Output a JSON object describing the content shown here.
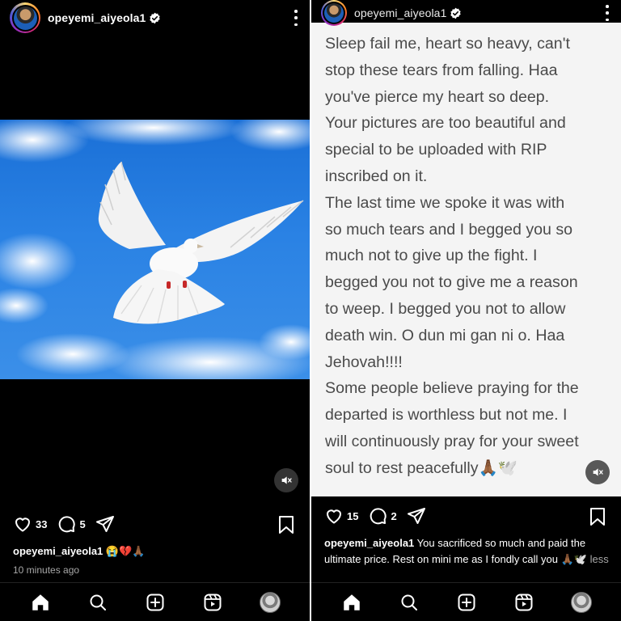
{
  "left": {
    "username": "opeyemi_aiyeola1",
    "likes": "33",
    "comments": "5",
    "caption_user": "opeyemi_aiyeola1",
    "caption_text": "😭💔🙏🏾",
    "time": "10 minutes ago"
  },
  "right": {
    "username": "opeyemi_aiyeola1",
    "post_text": "Sleep fail me, heart so heavy, can't\nstop these tears from falling. Haa\nyou've pierce my heart so deep.\nYour pictures are too beautiful and\nspecial to be uploaded with RIP\ninscribed on it.\nThe last time we spoke it was with\nso much tears and I begged you so\nmuch not to give up the fight. I\nbegged you not to give me a reason\nto weep. I begged you not to allow\ndeath win. O dun mi gan ni o. Haa\nJehovah!!!!\nSome people believe praying for the\ndeparted is worthless but not me. I\nwill continuously pray for your sweet\nsoul to rest peacefully🙏🏾🕊️",
    "likes": "15",
    "comments": "2",
    "caption_user": "opeyemi_aiyeola1",
    "caption_text": " You sacrificed so much and paid the ultimate price. Rest on mini me as I fondly call you 🙏🏾🕊️ ",
    "less": "less"
  },
  "icons": {
    "verified": "verified-badge-icon",
    "more": "more-vertical-icon",
    "like": "heart-icon",
    "comment": "comment-icon",
    "share": "send-icon",
    "save": "bookmark-icon",
    "mute": "speaker-muted-icon",
    "home": "home-icon",
    "search": "search-icon",
    "create": "plus-square-icon",
    "reels": "reels-icon",
    "profile": "profile-avatar"
  },
  "colors": {
    "background": "#000000",
    "text_card": "#f4f4f4",
    "text_card_ink": "#4a4a4a",
    "sky": "#2a82e4",
    "muted": "#a8a8a8"
  }
}
